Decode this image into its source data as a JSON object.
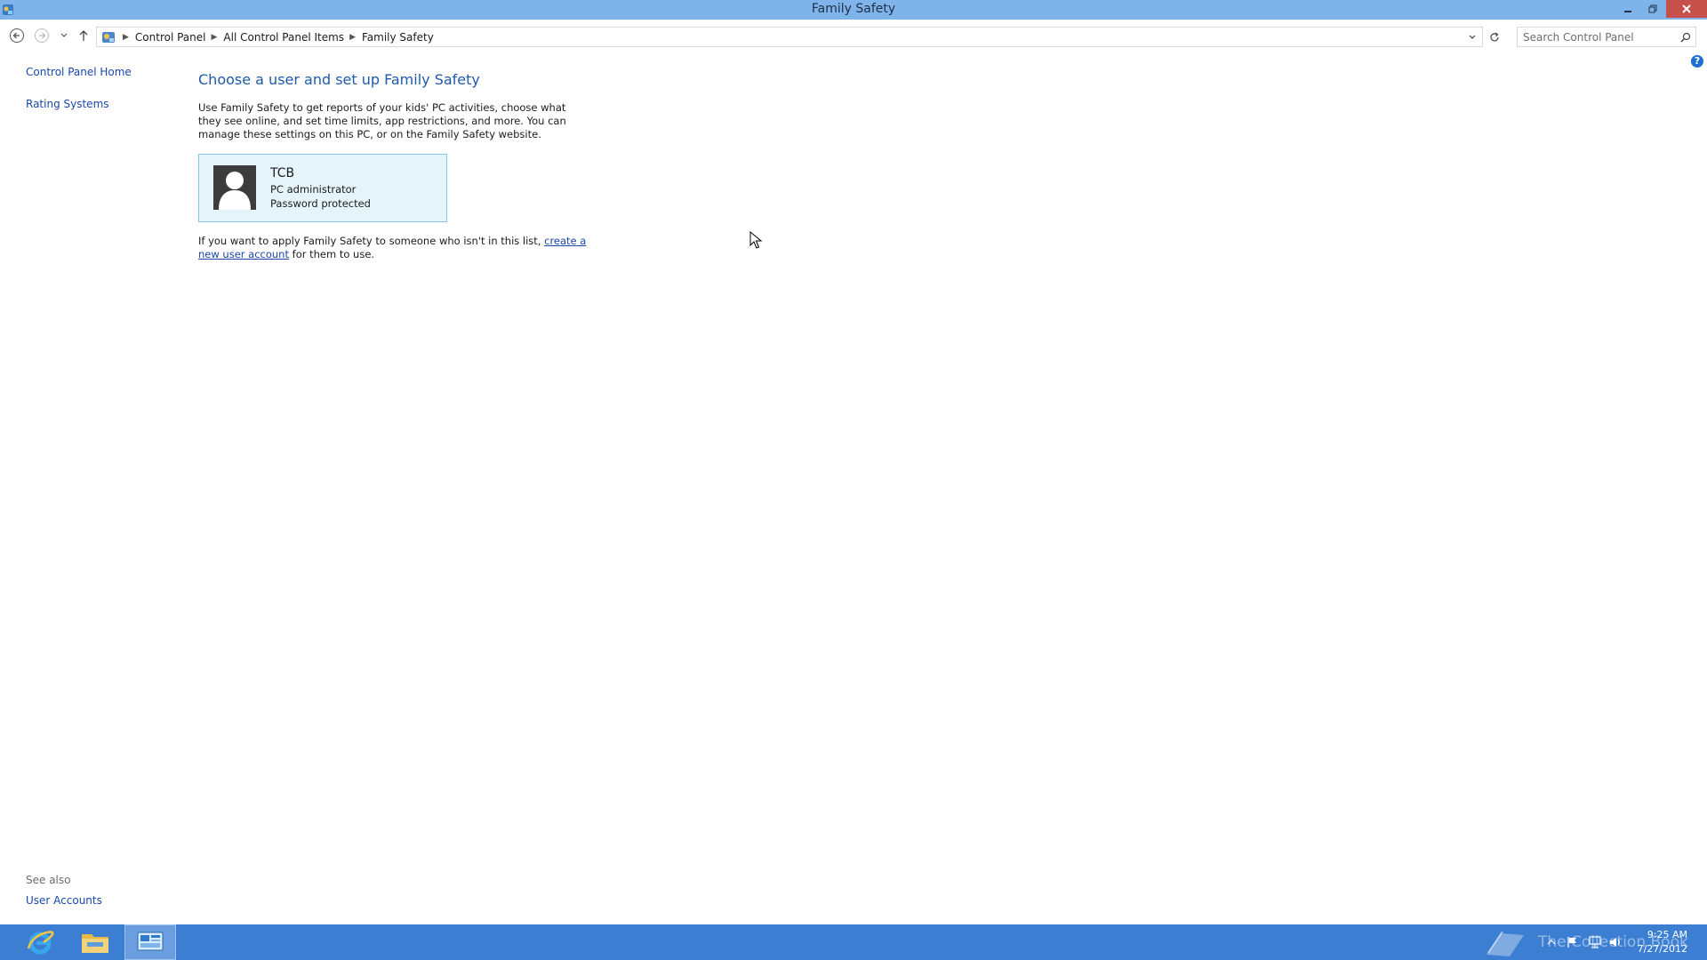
{
  "window": {
    "title": "Family Safety"
  },
  "nav": {
    "breadcrumb": [
      "Control Panel",
      "All Control Panel Items",
      "Family Safety"
    ],
    "search_placeholder": "Search Control Panel"
  },
  "left_pane": {
    "home": "Control Panel Home",
    "rating": "Rating Systems",
    "see_also": "See also",
    "user_accounts": "User Accounts"
  },
  "main": {
    "heading": "Choose a user and set up Family Safety",
    "description": "Use Family Safety to get reports of your kids' PC activities, choose what they see online, and set time limits, app restrictions, and more. You can manage these settings on this PC, or on the Family Safety website.",
    "user": {
      "name": "TCB",
      "role": "PC administrator",
      "status": "Password protected"
    },
    "note_prefix": "If you want to apply Family Safety to someone who isn't in this list,",
    "note_link": "create a new user account",
    "note_suffix": "for them to use."
  },
  "taskbar": {
    "time": "9:25 AM",
    "date": "7/27/2012",
    "watermark": "The Collection Book"
  },
  "icons": {
    "help": "?"
  },
  "colors": {
    "titlebar": "#7eb4ea",
    "close": "#c7514a",
    "link": "#1a47a8",
    "heading": "#1e5aa8",
    "card_bg": "#e5f3fb",
    "card_border": "#84c7ef",
    "taskbar": "#3c7fd2"
  }
}
